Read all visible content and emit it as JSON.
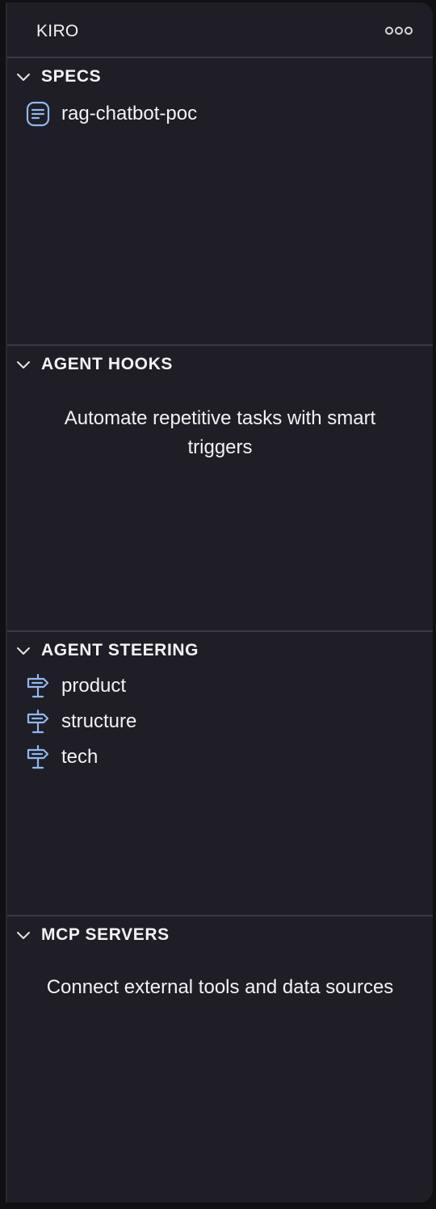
{
  "header": {
    "title": "KIRO",
    "more_icon": "ellipsis-icon"
  },
  "specs": {
    "title": "SPECS",
    "items": [
      {
        "label": "rag-chatbot-poc",
        "icon": "spec-document-icon"
      }
    ]
  },
  "agent_hooks": {
    "title": "AGENT HOOKS",
    "empty_text": "Automate repetitive tasks with smart triggers"
  },
  "agent_steering": {
    "title": "AGENT STEERING",
    "items": [
      {
        "label": "product",
        "icon": "signpost-icon"
      },
      {
        "label": "structure",
        "icon": "signpost-icon"
      },
      {
        "label": "tech",
        "icon": "signpost-icon"
      }
    ]
  },
  "mcp_servers": {
    "title": "MCP SERVERS",
    "empty_text": "Connect external tools and data sources"
  },
  "colors": {
    "panel_background": "#1f1e26",
    "icon_accent": "#8fb8f0",
    "divider": "#3a3942"
  }
}
